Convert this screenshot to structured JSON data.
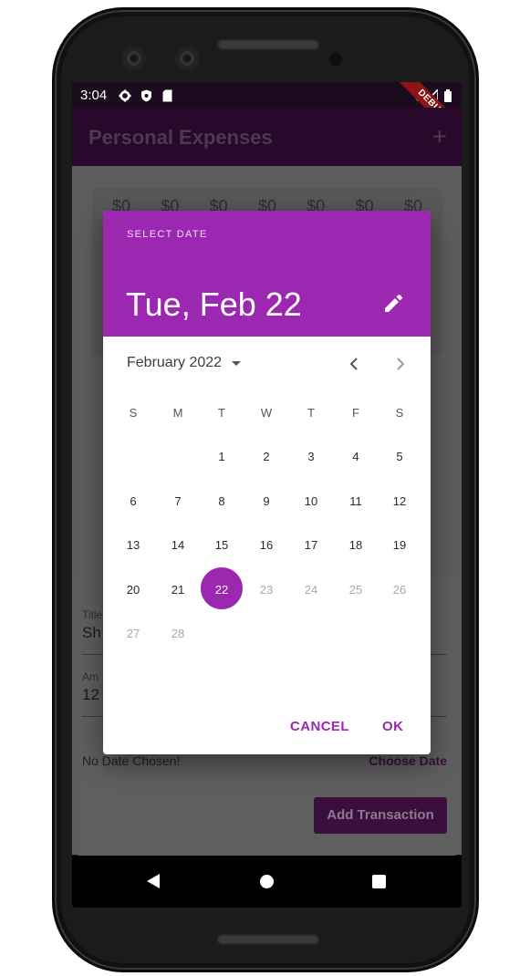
{
  "status_bar": {
    "time": "3:04",
    "debug_banner": "DEBUG"
  },
  "app_bar": {
    "title": "Personal Expenses",
    "add_icon": "plus-icon"
  },
  "chart": {
    "amounts": [
      "$0",
      "$0",
      "$0",
      "$0",
      "$0",
      "$0",
      "$0"
    ]
  },
  "form": {
    "title_label": "Title",
    "title_value": "Sh",
    "amount_label": "Am",
    "amount_value": "12",
    "no_date_text": "No Date Chosen!",
    "choose_date_label": "Choose Date",
    "add_button_label": "Add Transaction"
  },
  "date_picker": {
    "helper_text": "SELECT DATE",
    "selected_date_text": "Tue, Feb 22",
    "month_label": "February 2022",
    "weekdays": [
      "S",
      "M",
      "T",
      "W",
      "T",
      "F",
      "S"
    ],
    "weeks": [
      [
        "",
        "",
        "1",
        "2",
        "3",
        "4",
        "5"
      ],
      [
        "6",
        "7",
        "8",
        "9",
        "10",
        "11",
        "12"
      ],
      [
        "13",
        "14",
        "15",
        "16",
        "17",
        "18",
        "19"
      ],
      [
        "20",
        "21",
        "22",
        "23",
        "24",
        "25",
        "26"
      ],
      [
        "27",
        "28",
        "",
        "",
        "",
        "",
        ""
      ]
    ],
    "selected_day": "22",
    "disabled_days": [
      "23",
      "24",
      "25",
      "26",
      "27",
      "28"
    ],
    "cancel_label": "CANCEL",
    "ok_label": "OK",
    "accent_color": "#9c27b0"
  },
  "colors": {
    "header": "#9c27b0",
    "app_bar": "#28092b",
    "button": "#3a0f3e"
  }
}
